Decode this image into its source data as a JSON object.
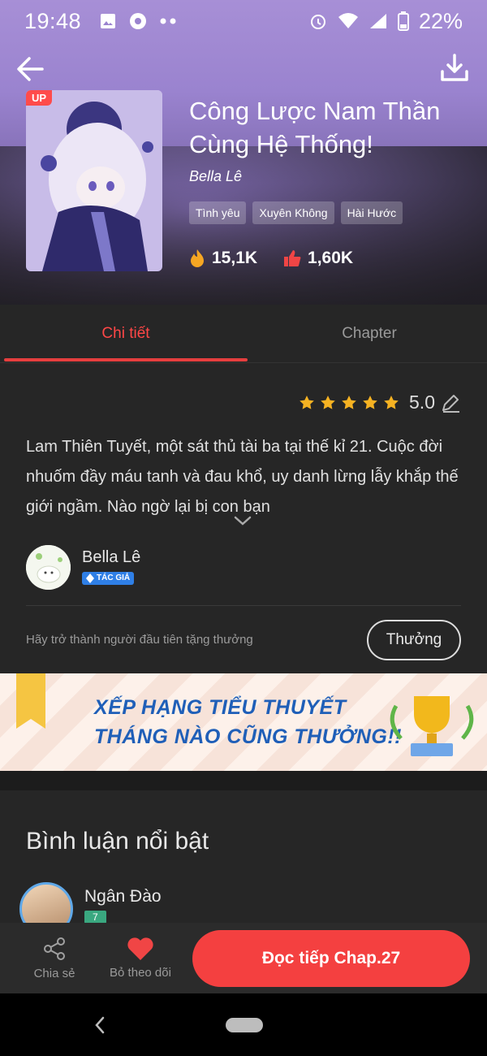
{
  "status_bar": {
    "time": "19:48",
    "battery": "22%"
  },
  "book": {
    "badge": "UP",
    "title": "Công Lược Nam Thần Cùng Hệ Thống!",
    "author": "Bella Lê",
    "tags": [
      "Tình yêu",
      "Xuyên Không",
      "Hài Hước"
    ],
    "views": "15,1K",
    "likes": "1,60K"
  },
  "tabs": {
    "details": "Chi tiết",
    "chapter": "Chapter"
  },
  "rating": {
    "value": "5.0",
    "stars": 5
  },
  "description": "Lam Thiên Tuyết, một sát thủ tài ba tại thế kỉ 21. Cuộc đời nhuốm đầy máu tanh và đau khổ, uy danh lừng lẫy khắp thế giới ngầm. Nào ngờ lại bị con bạn",
  "author_card": {
    "name": "Bella Lê",
    "role": "TÁC GIẢ"
  },
  "gift": {
    "text": "Hãy trở thành người đầu tiên tặng thưởng",
    "button": "Thưởng"
  },
  "banner": {
    "line1": "XẾP HẠNG TIỂU THUYẾT",
    "line2": "THÁNG NÀO CŨNG THƯỞNG!!"
  },
  "comments": {
    "title": "Bình luận nổi bật",
    "first": {
      "name": "Ngân Đào",
      "level": "7"
    }
  },
  "bottom_bar": {
    "share": "Chia sẻ",
    "unfollow": "Bỏ theo dõi",
    "read": "Đọc tiếp Chap.27"
  },
  "colors": {
    "accent": "#f44040",
    "tab_active": "#ff4747",
    "author_badge": "#2f7fe6"
  }
}
